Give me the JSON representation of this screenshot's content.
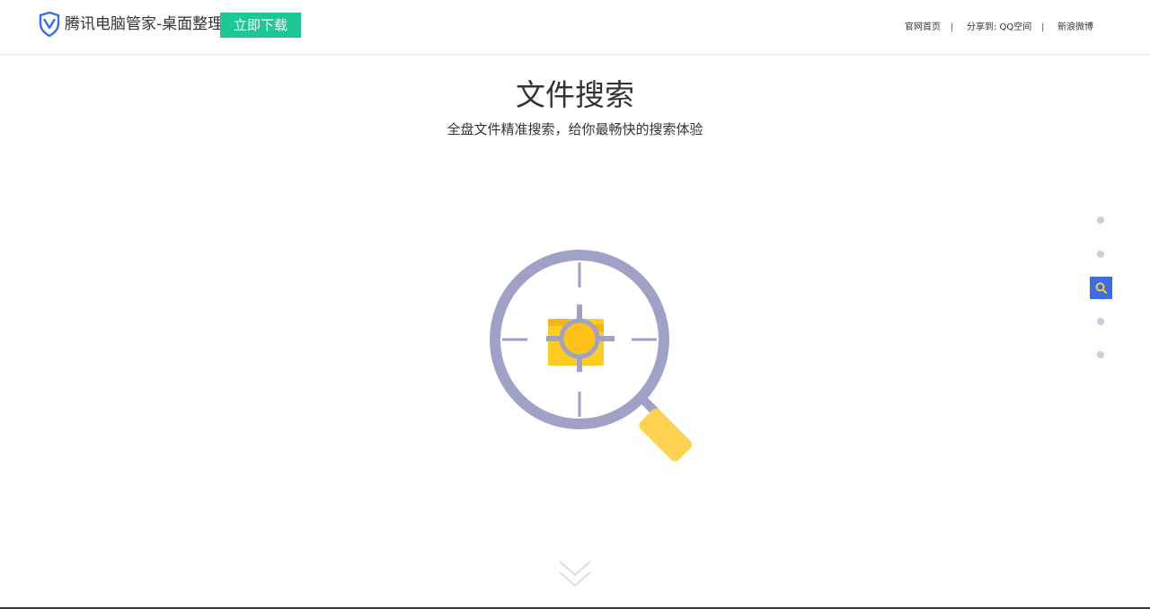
{
  "header": {
    "brand": "腾讯电脑管家-桌面整理",
    "download_label": "立即下载",
    "nav": {
      "home": "官网首页",
      "separator": "|",
      "share": "分享到:  QQ空间",
      "weibo": "新浪微博"
    }
  },
  "hero": {
    "title": "文件搜索",
    "subtitle": "全盘文件精准搜索，给你最畅快的搜索体验"
  },
  "side_nav": {
    "count": 5,
    "active_index": 2,
    "active_icon": "search-icon"
  },
  "icons": {
    "logo": "tencent-shield-logo",
    "illustration": "magnifier-folder-illustration",
    "scroll": "double-chevron-down-icon"
  },
  "colors": {
    "accent_green": "#1dc894",
    "accent_blue": "#3d6ce6",
    "magnifier_ring": "#9fa1c6",
    "folder_yellow": "#ffcc22",
    "handle_yellow": "#ffd34f"
  }
}
